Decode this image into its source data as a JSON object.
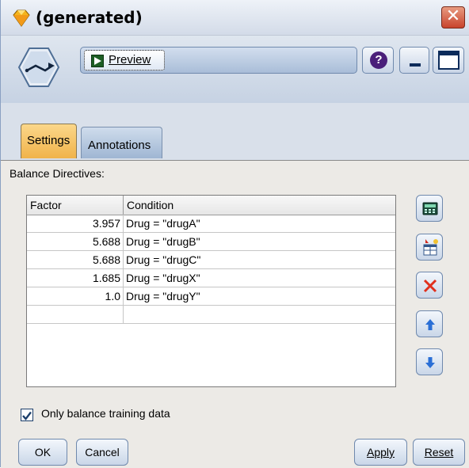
{
  "window": {
    "title": "(generated)",
    "close_glyph": "✕"
  },
  "toolbar": {
    "node_icon": "balance-node-icon",
    "preview_label": "Preview",
    "help_glyph": "?",
    "minimize_icon": "minimize-icon",
    "maximize_icon": "maximize-icon"
  },
  "tabs": [
    {
      "label": "Settings",
      "active": true
    },
    {
      "label": "Annotations",
      "active": false
    }
  ],
  "settings": {
    "section_label": "Balance Directives:",
    "columns": [
      "Factor",
      "Condition"
    ],
    "rows": [
      {
        "factor": "3.957",
        "condition": "Drug = \"drugA\""
      },
      {
        "factor": "5.688",
        "condition": "Drug = \"drugB\""
      },
      {
        "factor": "5.688",
        "condition": "Drug = \"drugC\""
      },
      {
        "factor": "1.685",
        "condition": "Drug = \"drugX\""
      },
      {
        "factor": "1.0",
        "condition": "Drug = \"drugY\""
      },
      {
        "factor": "",
        "condition": ""
      }
    ],
    "side_buttons": [
      "calculator-icon",
      "insert-row-icon",
      "delete-icon",
      "move-up-icon",
      "move-down-icon"
    ],
    "only_balance_training": {
      "label": "Only balance training data",
      "checked": true
    }
  },
  "buttons": {
    "ok": "OK",
    "cancel": "Cancel",
    "apply": "Apply",
    "reset": "Reset"
  },
  "colors": {
    "active_tab": "#f0b34a",
    "delete_icon": "#e0301e",
    "arrow_icon": "#2a6fd6"
  }
}
